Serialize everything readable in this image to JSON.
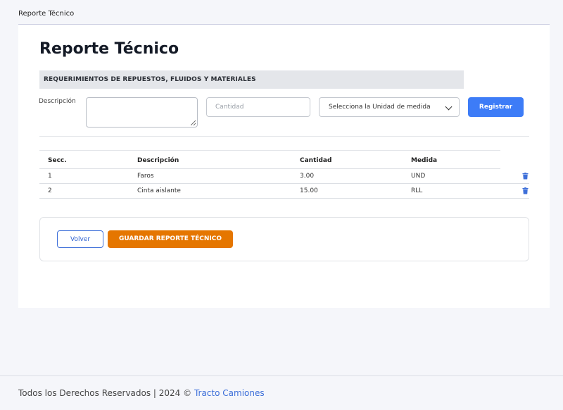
{
  "breadcrumb": "Reporte Técnico",
  "page_title": "Reporte Técnico",
  "section_title": "REQUERIMIENTOS DE REPUESTOS, FLUIDOS Y MATERIALES",
  "form": {
    "description_label": "Descripción",
    "description_value": "",
    "quantity_placeholder": "Cantidad",
    "unit_select_value": "Selecciona la Unidad de medida",
    "register_label": "Registrar"
  },
  "table": {
    "headers": [
      "Secc.",
      "Descripción",
      "Cantidad",
      "Medida"
    ],
    "rows": [
      {
        "secc": "1",
        "descripcion": "Faros",
        "cantidad": "3.00",
        "medida": "UND"
      },
      {
        "secc": "2",
        "descripcion": "Cinta aislante",
        "cantidad": "15.00",
        "medida": "RLL"
      }
    ]
  },
  "actions": {
    "back_label": "Volver",
    "save_label": "GUARDAR REPORTE TÉCNICO"
  },
  "footer": {
    "text": "Todos los Derechos Reservados  | 2024 © ",
    "link": "Tracto Camiones"
  },
  "colors": {
    "primary": "#3d7cf7",
    "warning": "#e57600",
    "delete_icon": "#3d6fd9"
  }
}
